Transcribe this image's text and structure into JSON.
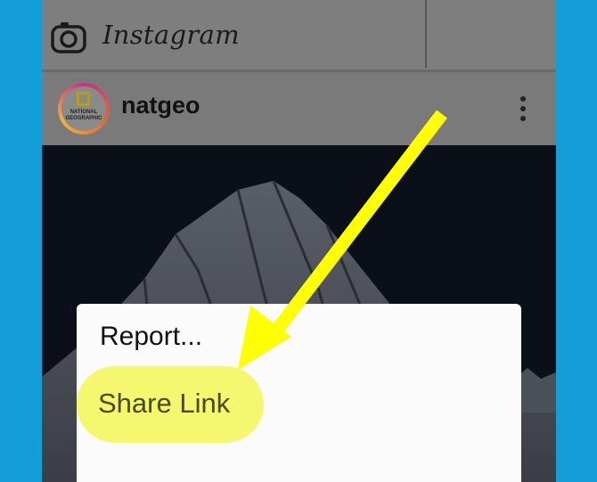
{
  "app": {
    "name": "Instagram"
  },
  "post": {
    "username": "natgeo",
    "avatar_text": "NATIONAL GEOGRAPHIC"
  },
  "menu": {
    "items": [
      "Report...",
      "Share Link"
    ]
  },
  "colors": {
    "background": "#139ed8",
    "overlay_gray": "#7b7b7b",
    "highlight": "#f5f76e",
    "arrow": "#ffff00"
  },
  "icons": [
    "camera-icon",
    "more-options-icon",
    "arrow-annotation"
  ]
}
